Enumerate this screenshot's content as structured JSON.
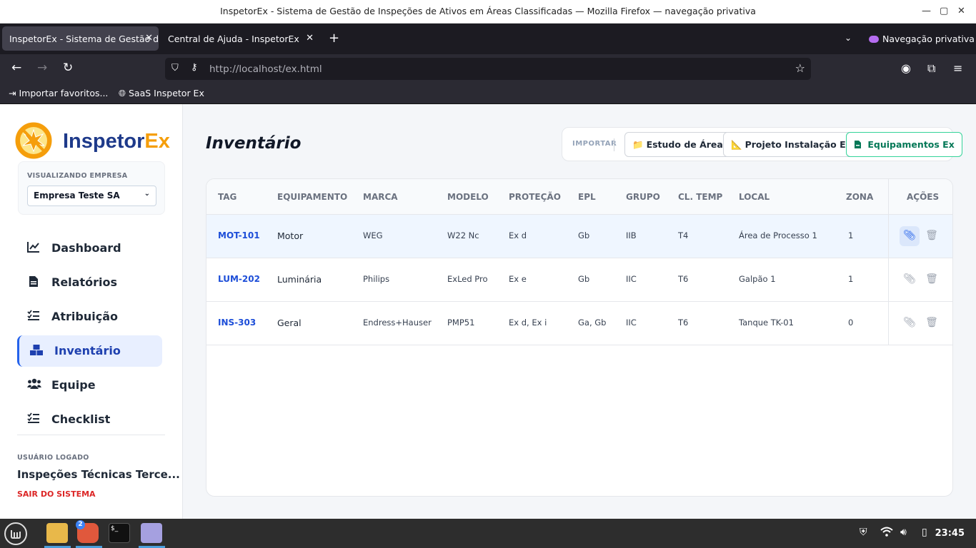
{
  "window": {
    "title": "InspetorEx - Sistema de Gestão de Inspeções de Ativos em Áreas Classificadas — Mozilla Firefox — navegação privativa"
  },
  "tabs": [
    {
      "label": "InspetorEx - Sistema de Gestão d",
      "active": true
    },
    {
      "label": "Central de Ajuda - InspetorEx",
      "active": false
    }
  ],
  "private_label": "Navegação privativa",
  "address": {
    "url": "http://localhost/ex.html"
  },
  "bookmarks": [
    "Importar favoritos...",
    "SaaS Inspetor Ex"
  ],
  "brand": {
    "name_main": "Inspetor",
    "name_accent": "Ex",
    "primary": "#1e3a8a",
    "accent": "#f59e0b"
  },
  "company": {
    "label": "VISUALIZANDO EMPRESA",
    "selected": "Empresa Teste SA"
  },
  "nav": [
    {
      "label": "Dashboard",
      "icon": "chart-line-icon",
      "glyph": "📈"
    },
    {
      "label": "Relatórios",
      "icon": "file-icon",
      "glyph": "📄"
    },
    {
      "label": "Atribuição",
      "icon": "list-check-icon",
      "glyph": "☰"
    },
    {
      "label": "Inventário",
      "icon": "boxes-icon",
      "glyph": "▦",
      "active": true
    },
    {
      "label": "Equipe",
      "icon": "users-icon",
      "glyph": "👥"
    },
    {
      "label": "Checklist",
      "icon": "list-check-icon",
      "glyph": "☰"
    }
  ],
  "user": {
    "label": "USUÁRIO LOGADO",
    "name": "Inspeções Técnicas Terce...",
    "logout": "SAIR DO SISTEMA"
  },
  "page": {
    "title": "Inventário"
  },
  "import": {
    "label": "IMPORTAR",
    "buttons": [
      {
        "label": "Estudo de Área",
        "icon": "folder-icon",
        "glyph": "📁"
      },
      {
        "label": "Projeto Instalação Ex",
        "icon": "ruler-icon",
        "glyph": "📐"
      },
      {
        "label": "Equipamentos Ex",
        "icon": "file-csv-icon",
        "glyph": "🗎"
      }
    ]
  },
  "table": {
    "headers": [
      "TAG",
      "EQUIPAMENTO",
      "MARCA",
      "MODELO",
      "PROTEÇÃO",
      "EPL",
      "GRUPO",
      "CL. TEMP",
      "LOCAL",
      "ZONA",
      "AÇÕES"
    ],
    "rows": [
      {
        "tag": "MOT-101",
        "equipamento": "Motor",
        "marca": "WEG",
        "modelo": "W22 Nc",
        "protecao": "Ex d",
        "epl": "Gb",
        "grupo": "IIB",
        "cltemp": "T4",
        "local": "Área de Processo 1",
        "zona": "1"
      },
      {
        "tag": "LUM-202",
        "equipamento": "Luminária",
        "marca": "Philips",
        "modelo": "ExLed Pro",
        "protecao": "Ex e",
        "epl": "Gb",
        "grupo": "IIC",
        "cltemp": "T6",
        "local": "Galpão 1",
        "zona": "1"
      },
      {
        "tag": "INS-303",
        "equipamento": "Geral",
        "marca": "Endress+Hauser",
        "modelo": "PMP51",
        "protecao": "Ex d, Ex i",
        "epl": "Ga, Gb",
        "grupo": "IIC",
        "cltemp": "T6",
        "local": "Tanque TK-01",
        "zona": "0"
      }
    ]
  },
  "taskbar": {
    "clock": "23:45",
    "badge": "2"
  }
}
